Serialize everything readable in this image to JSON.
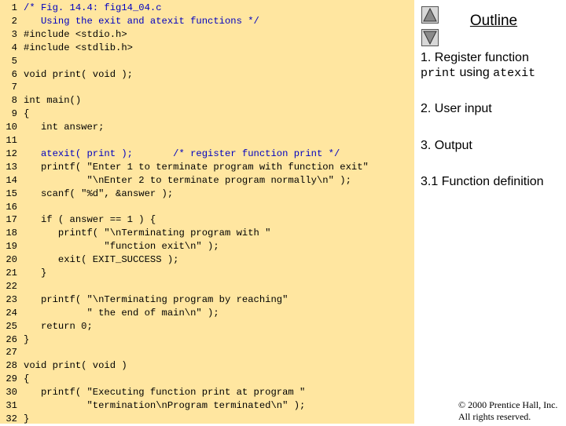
{
  "code": {
    "lines": [
      {
        "n": "1",
        "t": "/* Fig. 14.4: fig14_04.c"
      },
      {
        "n": "2",
        "t": "   Using the exit and atexit functions */"
      },
      {
        "n": "3",
        "t": "#include <stdio.h>"
      },
      {
        "n": "4",
        "t": "#include <stdlib.h>"
      },
      {
        "n": "5",
        "t": ""
      },
      {
        "n": "6",
        "t": "void print( void );"
      },
      {
        "n": "7",
        "t": ""
      },
      {
        "n": "8",
        "t": "int main()"
      },
      {
        "n": "9",
        "t": "{"
      },
      {
        "n": "10",
        "t": "   int answer;"
      },
      {
        "n": "11",
        "t": ""
      },
      {
        "n": "12",
        "t": "   atexit( print );       /* register function print */"
      },
      {
        "n": "13",
        "t": "   printf( \"Enter 1 to terminate program with function exit\""
      },
      {
        "n": "14",
        "t": "           \"\\nEnter 2 to terminate program normally\\n\" );"
      },
      {
        "n": "15",
        "t": "   scanf( \"%d\", &answer );"
      },
      {
        "n": "16",
        "t": ""
      },
      {
        "n": "17",
        "t": "   if ( answer == 1 ) {"
      },
      {
        "n": "18",
        "t": "      printf( \"\\nTerminating program with \""
      },
      {
        "n": "19",
        "t": "              \"function exit\\n\" );"
      },
      {
        "n": "20",
        "t": "      exit( EXIT_SUCCESS );"
      },
      {
        "n": "21",
        "t": "   }"
      },
      {
        "n": "22",
        "t": ""
      },
      {
        "n": "23",
        "t": "   printf( \"\\nTerminating program by reaching\""
      },
      {
        "n": "24",
        "t": "           \" the end of main\\n\" );"
      },
      {
        "n": "25",
        "t": "   return 0;"
      },
      {
        "n": "26",
        "t": "}"
      },
      {
        "n": "27",
        "t": ""
      },
      {
        "n": "28",
        "t": "void print( void )"
      },
      {
        "n": "29",
        "t": "{"
      },
      {
        "n": "30",
        "t": "   printf( \"Executing function print at program \""
      },
      {
        "n": "31",
        "t": "           \"termination\\nProgram terminated\\n\" );"
      },
      {
        "n": "32",
        "t": "}"
      }
    ]
  },
  "outline": {
    "title": "Outline",
    "item1_line1": "1. Register function",
    "item1_code1": "print",
    "item1_mid": " using ",
    "item1_code2": "atexit",
    "item2": "2. User input",
    "item3": "3. Output",
    "item4": "3.1 Function definition"
  },
  "nav": {
    "up_icon": "triangle-up-icon",
    "down_icon": "triangle-down-icon"
  },
  "footer": {
    "copyright_line1": "© 2000 Prentice Hall, Inc.",
    "copyright_line2": "All rights reserved."
  },
  "colors": {
    "code_background": "#ffe6a0",
    "comment_color": "#0000c0"
  }
}
